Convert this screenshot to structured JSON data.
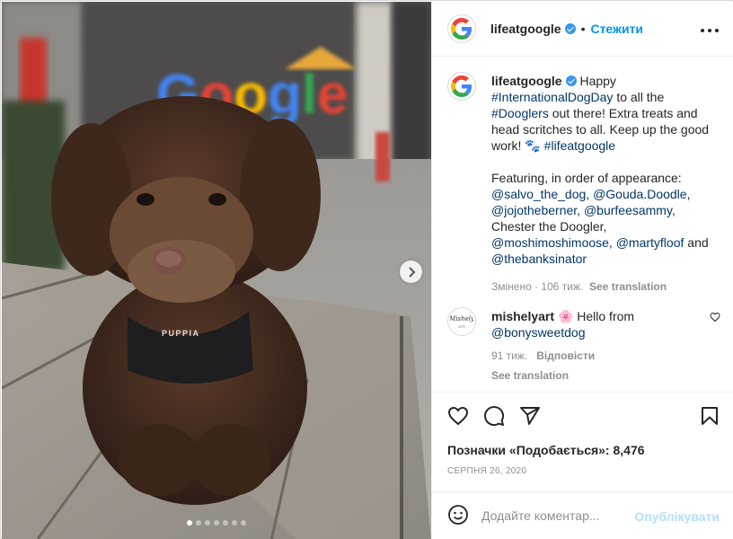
{
  "post": {
    "username": "lifeatgoogle",
    "separator": "•",
    "follow_label": "Стежити",
    "more_label": "•••",
    "caption": {
      "intro": "Happy",
      "hashtag_dogday": "#InternationalDogDay",
      "text1": "to all the",
      "hashtag_dooglers": "#Dooglers",
      "text2": "out there! Extra treats and head scritches to all. Keep up the good work!",
      "emoji": "🐾",
      "hashtag_life": "#lifeatgoogle",
      "featuring": "Featuring, in order of appearance:",
      "mention1": "@salvo_the_dog",
      "mention2": "@Gouda.Doodle",
      "mention3": "@jojotheberner",
      "mention4": "@burfeesammy",
      "chester": "Chester the Doogler,",
      "mention5": "@moshimoshimoose",
      "mention6": "@martyfloof",
      "and": "and",
      "mention7": "@thebanksinator",
      "edited": "Змінено · 106 тиж.",
      "see_translation": "See translation"
    }
  },
  "comment": {
    "username": "mishelyart",
    "emoji": "🌸",
    "text": "Hello from",
    "mention": "@bonysweetdog",
    "time": "91 тиж.",
    "reply": "Відповісти",
    "see_translation": "See translation",
    "avatar_text": "Mishely art"
  },
  "photo": {
    "sign_text": "Google",
    "harness_text": "PUPPIA",
    "slide_count": 7,
    "active_slide": 1
  },
  "actions": {
    "likes_label": "Позначки «Подобається»: 8,476",
    "date": "СЕРПНЯ 26, 2020"
  },
  "add_comment": {
    "placeholder": "Додайте коментар...",
    "publish_label": "Опублікувати"
  },
  "colors": {
    "link": "#00376b",
    "accent": "#0095f6",
    "publish_disabled": "#b2dffc",
    "muted": "#8e8e8e"
  }
}
